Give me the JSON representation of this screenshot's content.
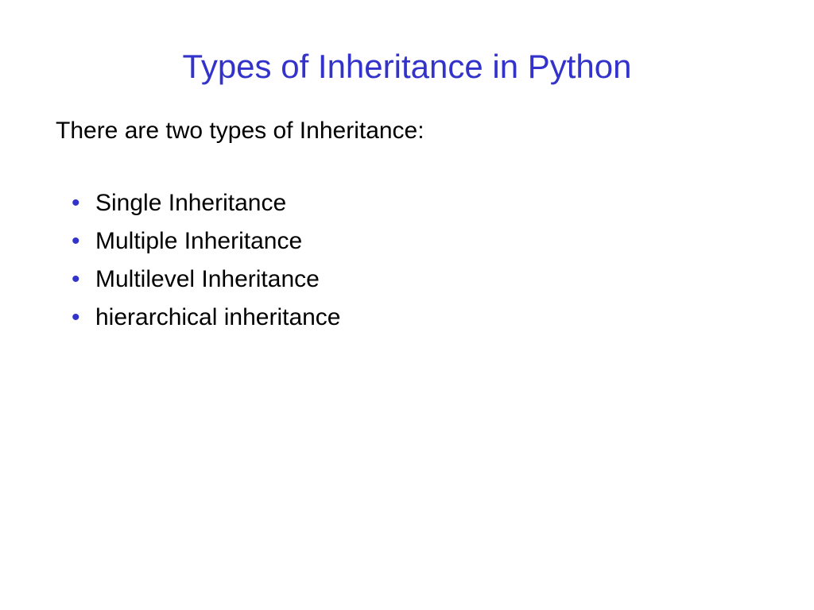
{
  "slide": {
    "title": "Types of Inheritance in Python",
    "intro": "There are two types of Inheritance:",
    "bullets": [
      "Single Inheritance",
      "Multiple Inheritance",
      "Multilevel Inheritance",
      "hierarchical inheritance"
    ]
  }
}
